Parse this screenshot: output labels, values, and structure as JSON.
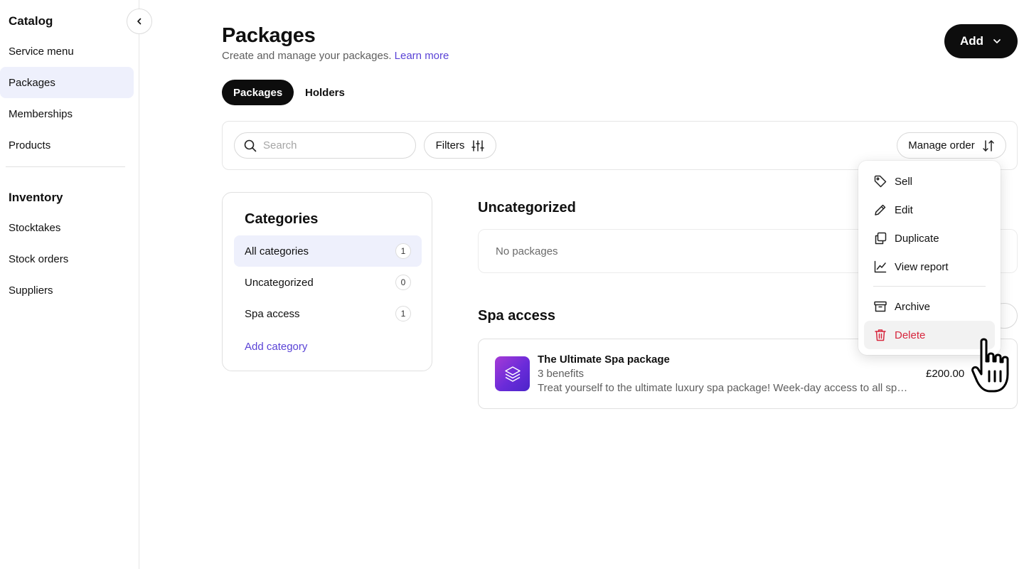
{
  "sidebar": {
    "catalog_title": "Catalog",
    "catalog_items": [
      {
        "label": "Service menu",
        "active": false
      },
      {
        "label": "Packages",
        "active": true
      },
      {
        "label": "Memberships",
        "active": false
      },
      {
        "label": "Products",
        "active": false
      }
    ],
    "inventory_title": "Inventory",
    "inventory_items": [
      {
        "label": "Stocktakes"
      },
      {
        "label": "Stock orders"
      },
      {
        "label": "Suppliers"
      }
    ],
    "collapse_icon": "chevron-left-icon"
  },
  "header": {
    "title": "Packages",
    "subtitle": "Create and manage your packages.",
    "learn_more": "Learn more",
    "add_label": "Add"
  },
  "tabs": [
    {
      "label": "Packages",
      "active": true
    },
    {
      "label": "Holders",
      "active": false
    }
  ],
  "toolbar": {
    "search_placeholder": "Search",
    "search_value": "",
    "filters_label": "Filters",
    "manage_order_label": "Manage order"
  },
  "categories": {
    "title": "Categories",
    "items": [
      {
        "label": "All categories",
        "count": "1",
        "active": true
      },
      {
        "label": "Uncategorized",
        "count": "0",
        "active": false
      },
      {
        "label": "Spa access",
        "count": "1",
        "active": false
      }
    ],
    "add_label": "Add category"
  },
  "sections": {
    "uncategorized": {
      "title": "Uncategorized",
      "empty_text": "No packages"
    },
    "spa_access": {
      "title": "Spa access",
      "package": {
        "name": "The Ultimate Spa package",
        "benefits": "3 benefits",
        "description": "Treat yourself to the ultimate luxury spa package! Week-day access to all spa facilities",
        "price": "£200.00"
      }
    }
  },
  "menu": {
    "items": [
      {
        "label": "Sell",
        "icon": "tag-icon"
      },
      {
        "label": "Edit",
        "icon": "pencil-icon"
      },
      {
        "label": "Duplicate",
        "icon": "copy-icon"
      },
      {
        "label": "View report",
        "icon": "chart-line-icon"
      },
      {
        "label": "Archive",
        "icon": "archive-icon"
      },
      {
        "label": "Delete",
        "icon": "trash-icon"
      }
    ],
    "danger_color": "#d7263d"
  },
  "colors": {
    "accent": "#5a43d6",
    "active_bg": "#eef0fc",
    "primary_button": "#0d0d0d"
  }
}
